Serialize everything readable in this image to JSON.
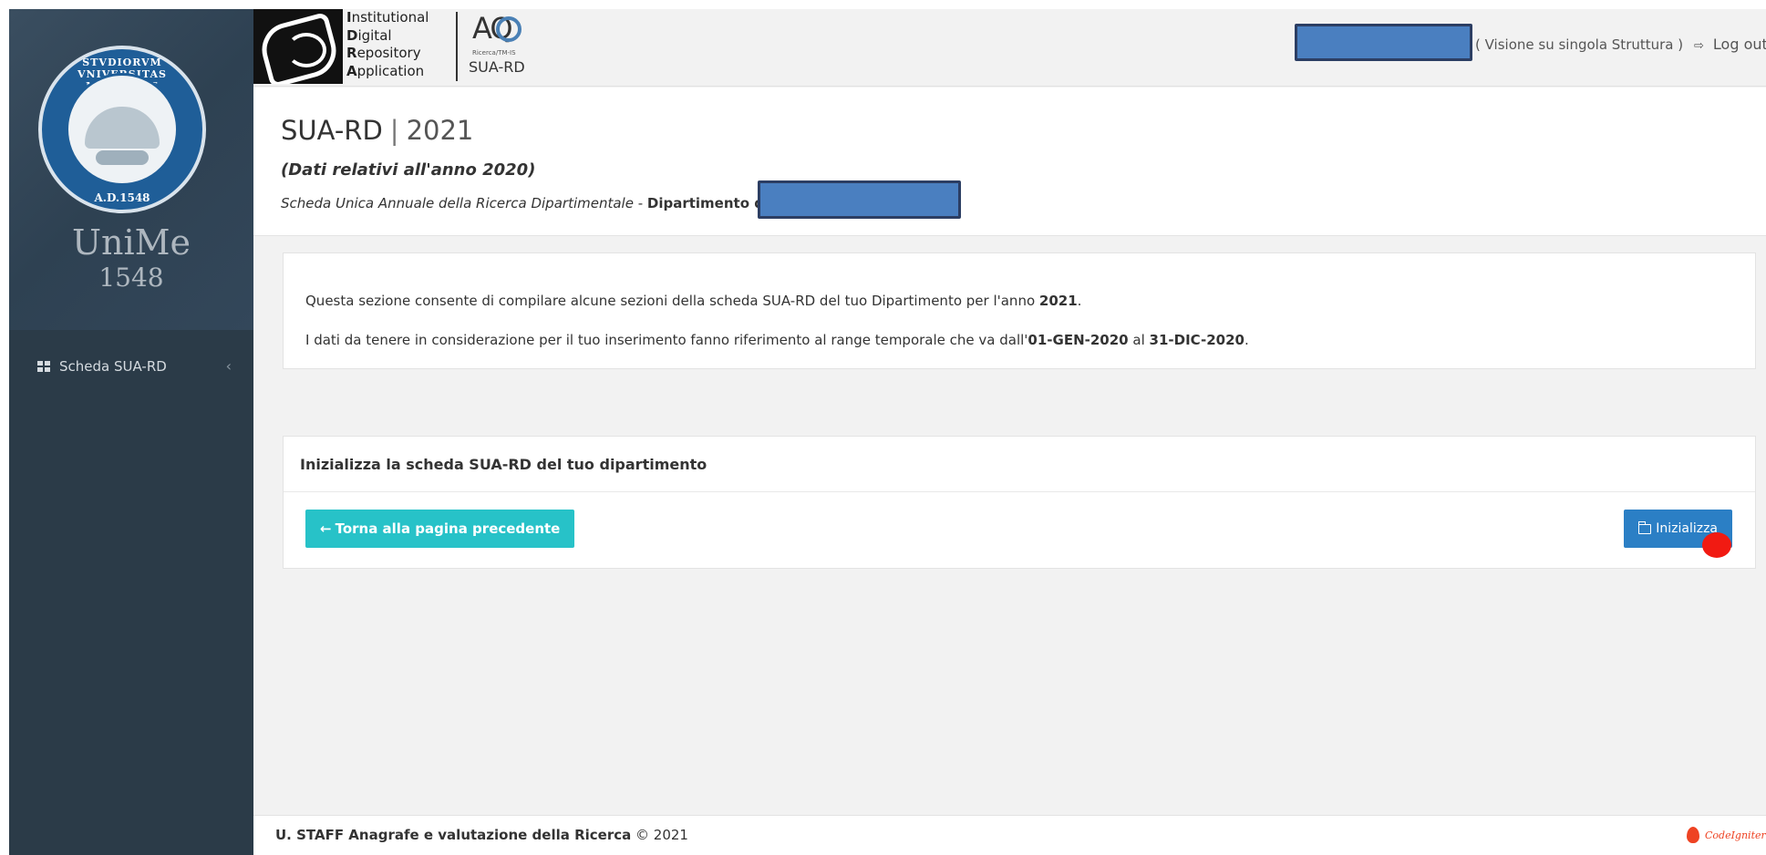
{
  "sidebar": {
    "seal_top_text": "STVDIORVM VNIVERSITAS MESSANAE",
    "seal_bottom_text": "A.D.1548",
    "brand_name": "UniMe",
    "brand_year": "1548",
    "items": [
      {
        "label": "Scheda SUA-RD",
        "chevron": "‹"
      }
    ]
  },
  "header": {
    "idra_lines": [
      {
        "initial": "I",
        "rest": "nstitutional"
      },
      {
        "initial": "D",
        "rest": "igital"
      },
      {
        "initial": "R",
        "rest": "epository"
      },
      {
        "initial": "A",
        "rest": "pplication"
      }
    ],
    "aq_letters": "AQ",
    "aq_small": "Ricerca/TM-IS",
    "aq_label": "SUA-RD",
    "vision_text": "( Visione su singola Struttura )",
    "logout_icon": "⇨",
    "logout_label": "Log out"
  },
  "page": {
    "title_main": "SUA-RD",
    "title_sep": "|",
    "title_year": "2021",
    "subtitle": "(Dati relativi all'anno 2020)",
    "desc_italic": "Scheda Unica Annuale della Ricerca Dipartimentale",
    "desc_dash": " - ",
    "desc_bold": "Dipartimento di"
  },
  "info": {
    "line1_pre": "Questa sezione consente di compilare alcune sezioni della scheda SUA-RD del tuo Dipartimento per l'anno ",
    "line1_year": "2021",
    "line1_post": ".",
    "line2_pre": "I dati da tenere in considerazione per il tuo inserimento fanno riferimento al range temporale che va dall'",
    "line2_from": "01-GEN-2020",
    "line2_mid": " al ",
    "line2_to": "31-DIC-2020",
    "line2_post": "."
  },
  "action": {
    "heading": "Inizializza la scheda SUA-RD del tuo dipartimento",
    "back_arrow": "←",
    "back_label": "Torna alla pagina precedente",
    "init_label": "Inizializza"
  },
  "footer": {
    "org": "U. STAFF Anagrafe e valutazione della Ricerca",
    "copyright": " © 2021",
    "framework": "CodeIgniter"
  },
  "colors": {
    "sidebar_bg": "#2b3b48",
    "back_button": "#27c2c8",
    "init_button": "#2b7fc5",
    "redaction": "#4a7fc0",
    "click_marker": "#f11a12"
  }
}
